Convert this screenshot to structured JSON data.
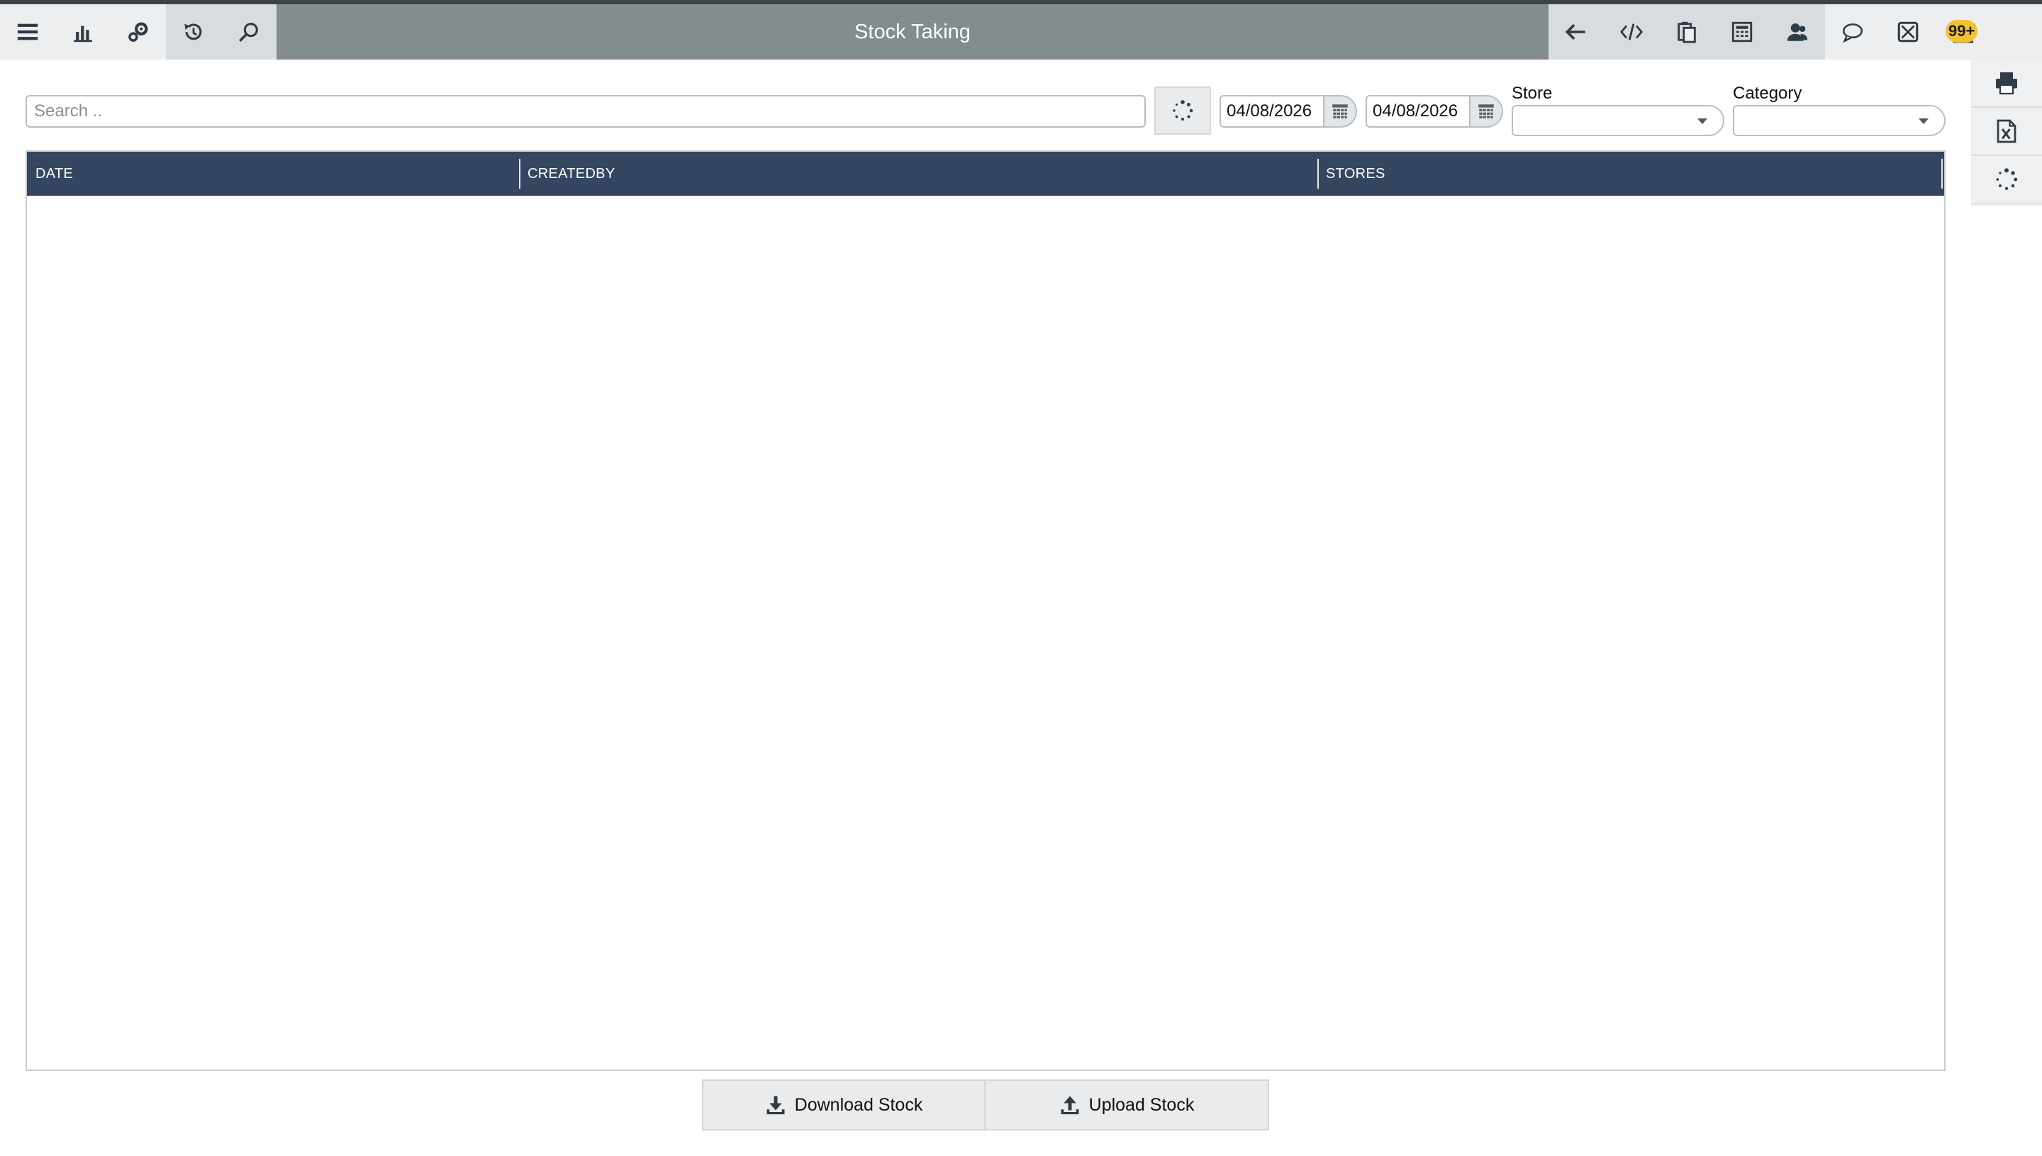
{
  "window": {
    "title": "Stock Taking"
  },
  "toolbar": {
    "left_icons": [
      "menu-icon",
      "bar-chart-icon",
      "settings-gears-icon",
      "history-icon",
      "search-icon"
    ],
    "right_icons": [
      "back-arrow-icon",
      "code-icon",
      "clipboard-icon",
      "calculator-icon",
      "users-icon"
    ],
    "extra_icons": [
      "chat-icon",
      "mail-icon",
      "user-icon"
    ],
    "notification_badge": "99+"
  },
  "filters": {
    "search_placeholder": "Search ..",
    "search_value": "",
    "date_from": "04/08/2026",
    "date_to": "04/08/2026",
    "store_label": "Store",
    "store_value": "",
    "category_label": "Category",
    "category_value": ""
  },
  "grid": {
    "columns": [
      "DATE",
      "CREATEDBY",
      "STORES"
    ],
    "rows": []
  },
  "side_panel": {
    "icons": [
      "print-icon",
      "excel-export-icon",
      "refresh-icon"
    ]
  },
  "actions": {
    "download_label": "Download Stock",
    "upload_label": "Upload Stock"
  },
  "colors": {
    "title_bar": "#838c8f",
    "grid_header": "#354760",
    "badge": "#f1c232"
  }
}
